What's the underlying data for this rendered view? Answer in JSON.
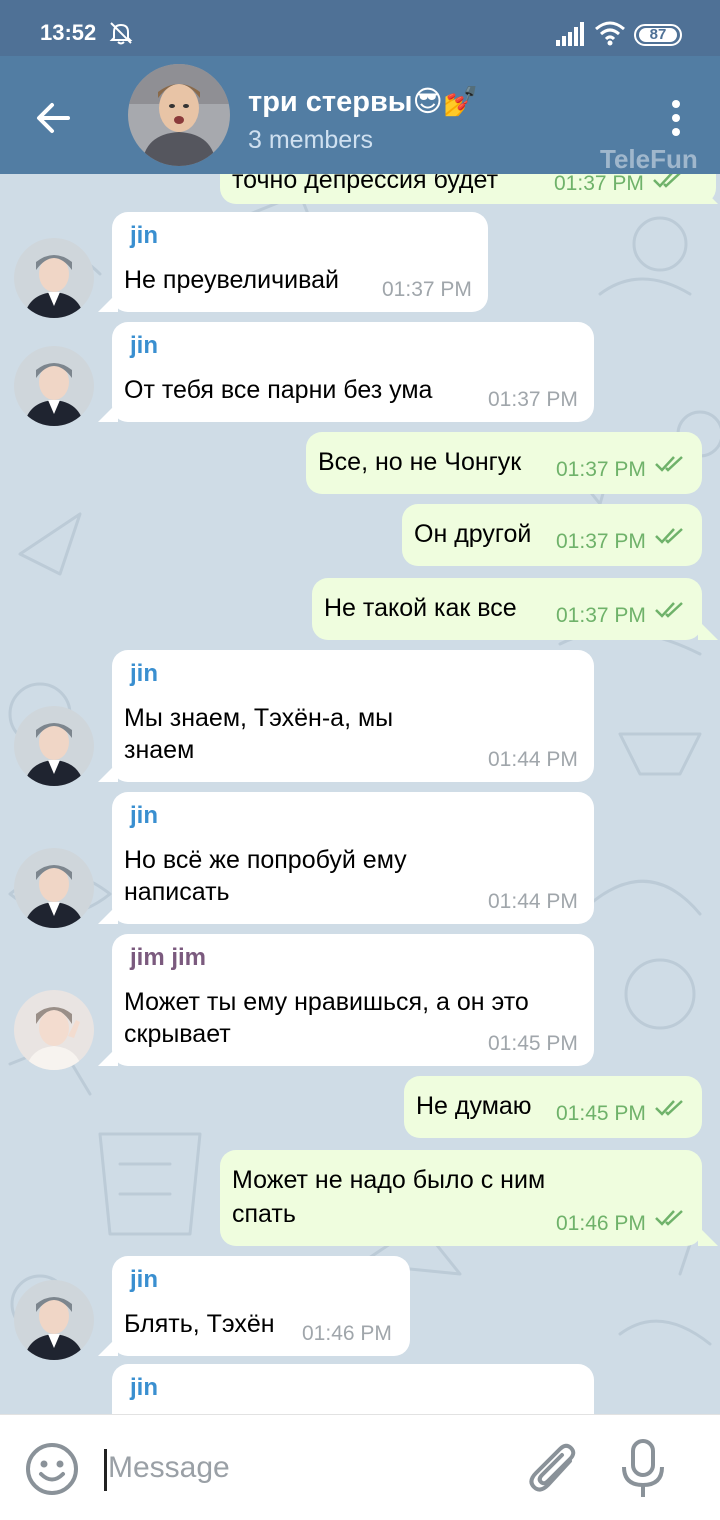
{
  "status_bar": {
    "time": "13:52",
    "battery": "87",
    "icons": [
      "mute-bell-icon",
      "signal-icon",
      "wifi-icon",
      "battery-icon"
    ]
  },
  "header": {
    "title": "три стервы😎💅",
    "subtitle": "3 members",
    "icons": [
      "back-arrow-icon",
      "more-vertical-icon"
    ]
  },
  "watermark": "TeleFun",
  "messages": [
    {
      "dir": "out",
      "text": "точно депрессия будет",
      "time": "01:37 PM"
    },
    {
      "dir": "in",
      "sender": "jin",
      "text": "Не преувеличивай",
      "time": "01:37 PM"
    },
    {
      "dir": "in",
      "sender": "jin",
      "text": "От тебя все парни без ума",
      "time": "01:37 PM"
    },
    {
      "dir": "out",
      "text": "Все, но не Чонгук",
      "time": "01:37 PM"
    },
    {
      "dir": "out",
      "text": "Он другой",
      "time": "01:37 PM"
    },
    {
      "dir": "out",
      "text": "Не такой как все",
      "time": "01:37 PM"
    },
    {
      "dir": "in",
      "sender": "jin",
      "text_line1": "Мы знаем, Тэхён-а, мы",
      "text_line2": "знаем",
      "time": "01:44 PM"
    },
    {
      "dir": "in",
      "sender": "jin",
      "text_line1": "Но всё же попробуй ему",
      "text_line2": "написать",
      "time": "01:44 PM"
    },
    {
      "dir": "in",
      "sender": "jim jim",
      "text_line1": "Может ты ему нравишься, а он это",
      "text_line2": "скрывает",
      "time": "01:45 PM"
    },
    {
      "dir": "out",
      "text": "Не думаю",
      "time": "01:45 PM"
    },
    {
      "dir": "out",
      "text_line1": "Может не надо было с ним",
      "text_line2": "спать",
      "time": "01:46 PM"
    },
    {
      "dir": "in",
      "sender": "jin",
      "text": "Блять, Тэхён",
      "time": "01:46 PM"
    },
    {
      "dir": "in",
      "sender": "jin",
      "text": ""
    }
  ],
  "composer": {
    "placeholder": "Message",
    "icons": [
      "emoji-icon",
      "attach-paperclip-icon",
      "microphone-icon"
    ]
  },
  "colors": {
    "header": "#527da3",
    "status_bar": "#4f7196",
    "chat_bg": "#cfdce6",
    "bubble_in": "#ffffff",
    "bubble_out": "#effdde",
    "sender_jin": "#3a8fd0",
    "sender_jim": "#7b5a7e",
    "check": "#6fb26a"
  }
}
